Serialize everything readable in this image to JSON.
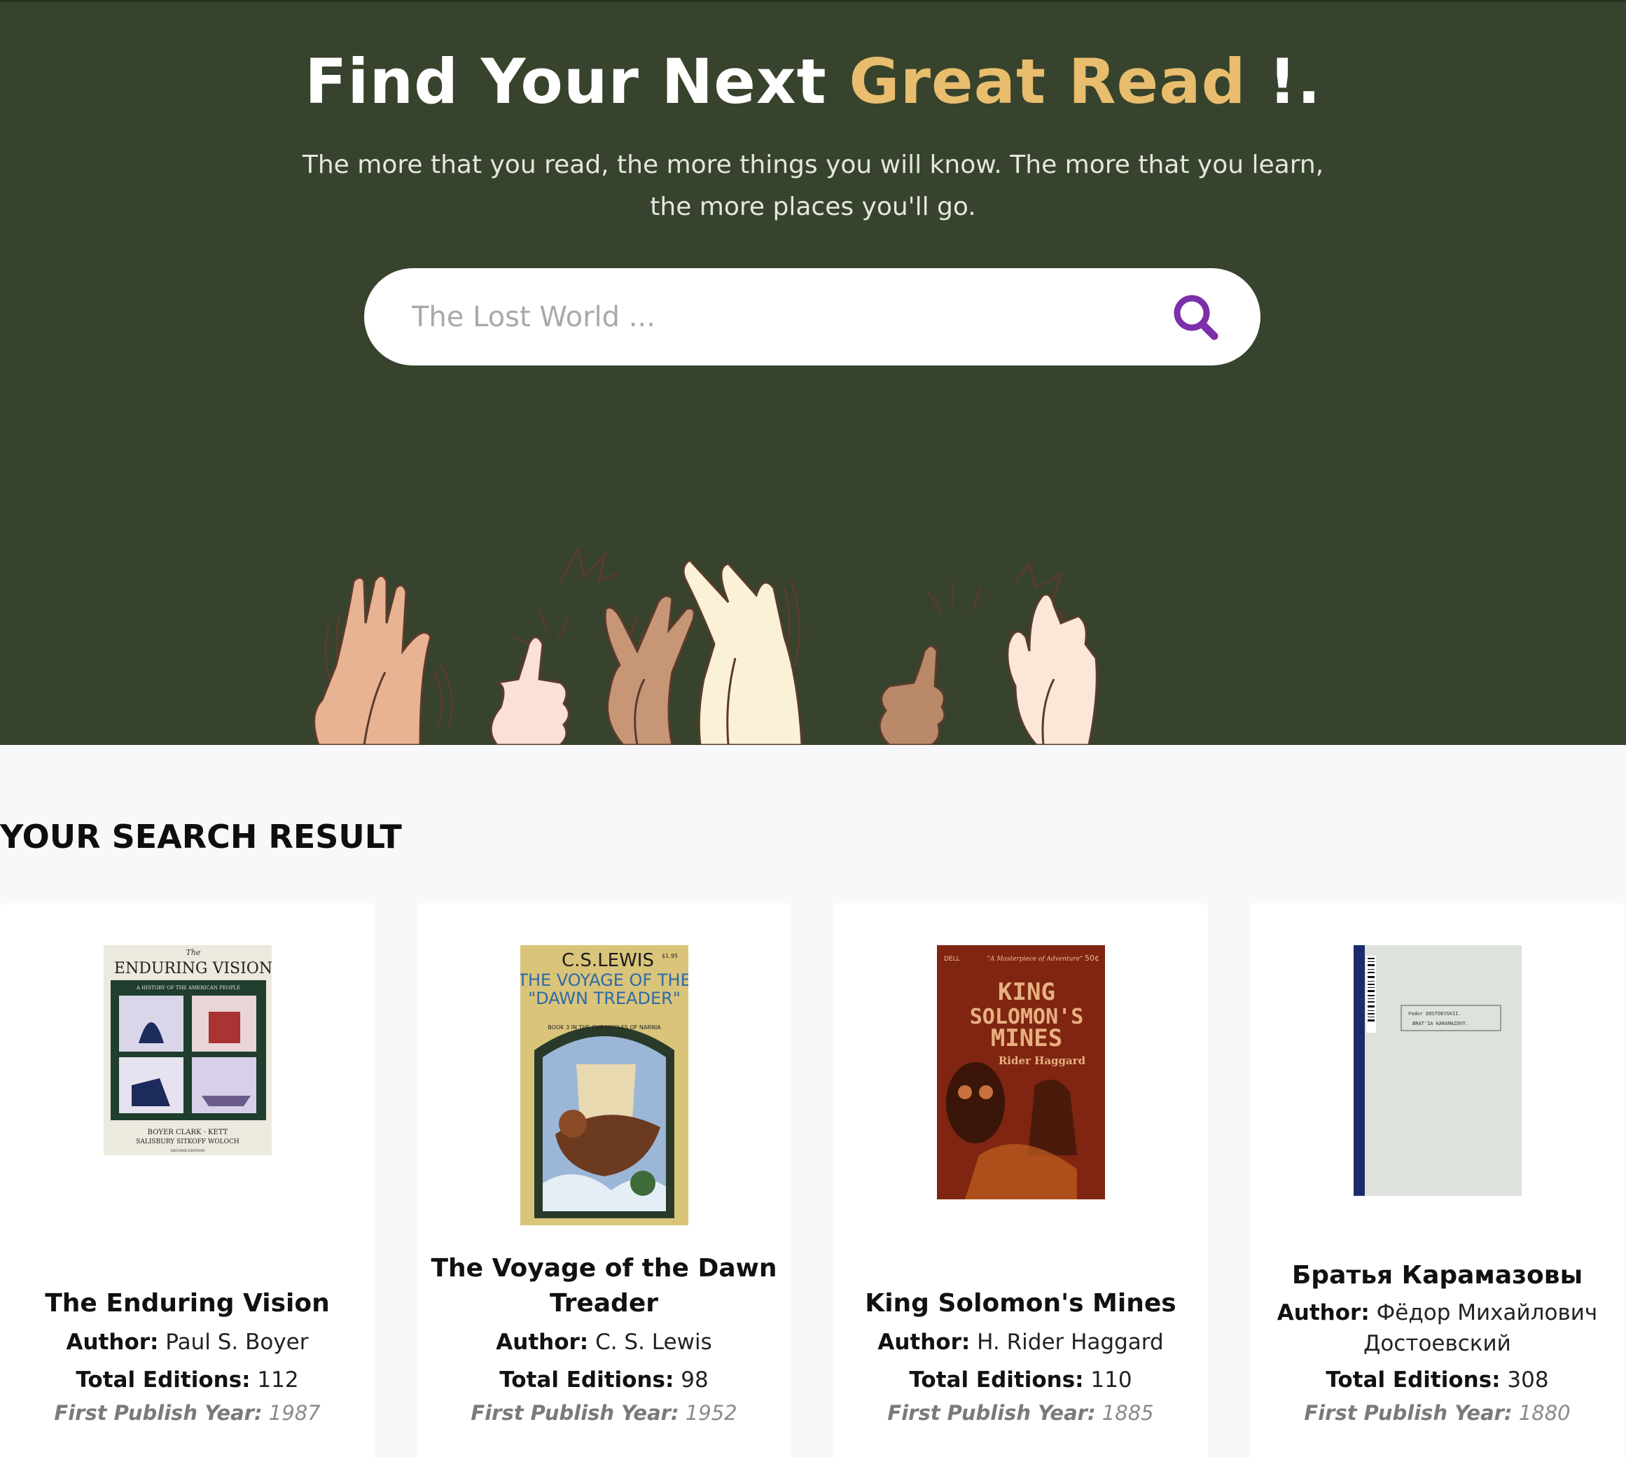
{
  "hero": {
    "title_part1": "Find Your Next ",
    "title_accent": "Great Read",
    "title_part2": " !.",
    "subtitle": "The more that you read, the more things you will know. The more that you learn, the more places you'll go.",
    "accent_color": "#e8bd6e",
    "background_color": "#37432c"
  },
  "search": {
    "placeholder": "The Lost World ...",
    "icon": "search-icon",
    "icon_color": "#7b2fa8"
  },
  "results": {
    "heading": "YOUR SEARCH RESULT",
    "author_label": "Author:",
    "editions_label": "Total Editions:",
    "year_label": "First Publish Year:",
    "books": [
      {
        "title": "The Enduring Vision",
        "author": "Paul S. Boyer",
        "editions": "112",
        "year": "1987",
        "cover": {
          "top_small": "The",
          "title": "ENDURING VISION",
          "subtitle": "A HISTORY OF THE AMERICAN PEOPLE",
          "authors1": "BOYER  CLARK · KETT",
          "authors2": "SALISBURY  SITKOFF  WOLOCH",
          "edition": "SECOND EDITION"
        }
      },
      {
        "title": "The Voyage of the Dawn Treader",
        "author": "C. S. Lewis",
        "editions": "98",
        "year": "1952",
        "cover": {
          "author": "C.S.LEWIS",
          "price": "$1.95",
          "title1": "THE VOYAGE OF THE",
          "title2": "\"DAWN TREADER\"",
          "series": "BOOK 3 IN THE CHRONICLES OF NARNIA"
        }
      },
      {
        "title": "King Solomon's Mines",
        "author": "H. Rider Haggard",
        "editions": "110",
        "year": "1885",
        "cover": {
          "tagline": "\"A Masterpiece of Adventure\"",
          "price": "50¢",
          "publisher": "DELL",
          "title1": "KING",
          "title2": "SOLOMON'S",
          "title3": "MINES",
          "author": "Rider Haggard"
        }
      },
      {
        "title": "Братья Карамазовы",
        "author": "Фёдор Михайлович Достоевский",
        "editions": "308",
        "year": "1880",
        "cover": {
          "label1": "Fedor DOSTOEVSKII.",
          "label2": "BRAT'IA KARAMAZOVY."
        }
      }
    ]
  }
}
